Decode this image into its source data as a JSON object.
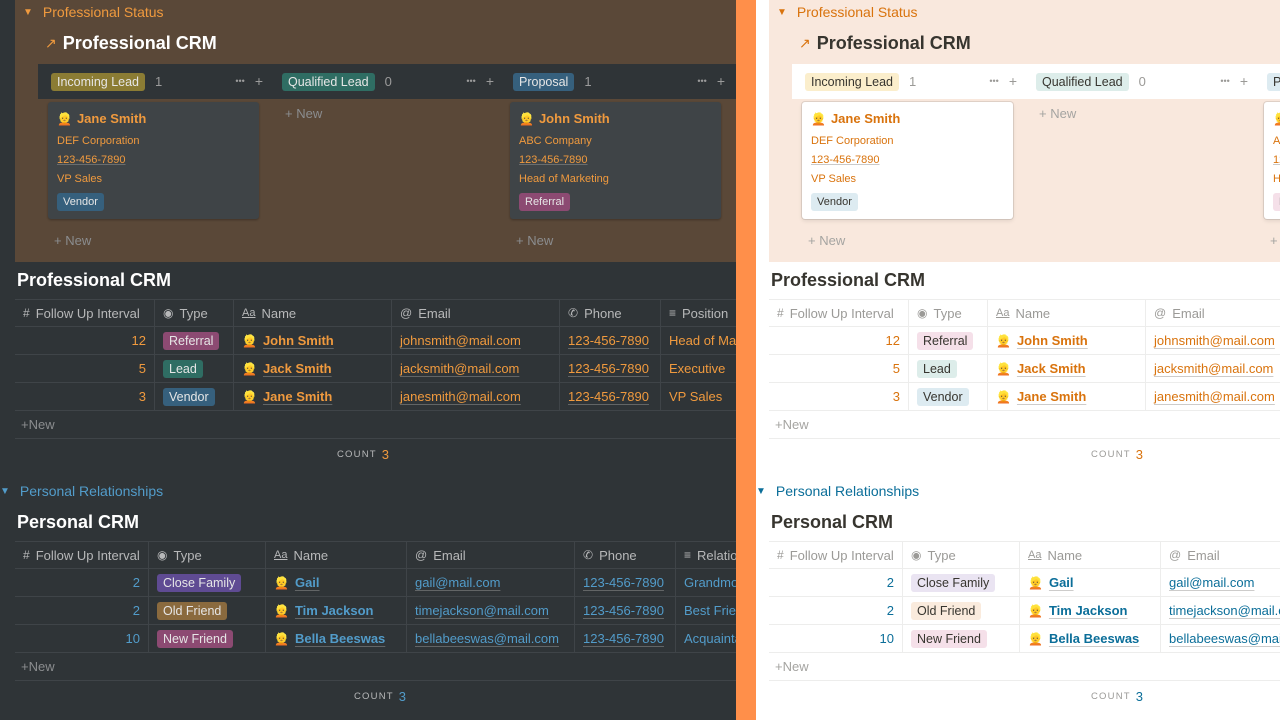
{
  "themes": [
    "dark",
    "light"
  ],
  "divider_color": "#ff8f4a",
  "status_section": {
    "toggle_label": "Professional Status",
    "linked_db_title": "Professional CRM",
    "columns": [
      {
        "label": "Incoming Lead",
        "count": "1",
        "tag_dark": "#8b7c34",
        "tag_light": "#fbeecc"
      },
      {
        "label": "Qualified Lead",
        "count": "0",
        "tag_dark": "#2f6d63",
        "tag_light": "#ddedea"
      },
      {
        "label": "Proposal",
        "count": "1",
        "tag_dark": "#36607d",
        "tag_light": "#ddebf1"
      }
    ],
    "cards": [
      {
        "column": 0,
        "name": "Jane Smith",
        "emoji": "👱",
        "company": "DEF Corporation",
        "phone": "123-456-7890",
        "position": "VP Sales",
        "type": "Vendor"
      },
      {
        "column": 2,
        "name": "John Smith",
        "emoji": "👱",
        "company": "ABC Company",
        "phone": "123-456-7890",
        "position": "Head of Marketing",
        "type": "Referral"
      }
    ],
    "new_label": "New"
  },
  "professional_table": {
    "title": "Professional CRM",
    "headers": [
      {
        "icon": "#",
        "label": "Follow Up Interval"
      },
      {
        "icon": "◉",
        "label": "Type"
      },
      {
        "icon": "Aa",
        "label": "Name"
      },
      {
        "icon": "@",
        "label": "Email"
      },
      {
        "icon": "✆",
        "label": "Phone"
      },
      {
        "icon": "≡",
        "label": "Position"
      }
    ],
    "rows": [
      {
        "interval": "12",
        "type": "Referral",
        "name": "John Smith",
        "email": "johnsmith@mail.com",
        "phone": "123-456-7890",
        "position": "Head of Marketing"
      },
      {
        "interval": "5",
        "type": "Lead",
        "name": "Jack Smith",
        "email": "jacksmith@mail.com",
        "phone": "123-456-7890",
        "position": "Executive"
      },
      {
        "interval": "3",
        "type": "Vendor",
        "name": "Jane Smith",
        "email": "janesmith@mail.com",
        "phone": "123-456-7890",
        "position": "VP Sales"
      }
    ],
    "new_label": "New",
    "count_label": "COUNT",
    "count_value": "3"
  },
  "personal_section": {
    "toggle_label": "Personal Relationships"
  },
  "personal_table": {
    "title": "Personal CRM",
    "headers": [
      {
        "icon": "#",
        "label": "Follow Up Interval"
      },
      {
        "icon": "◉",
        "label": "Type"
      },
      {
        "icon": "Aa",
        "label": "Name"
      },
      {
        "icon": "@",
        "label": "Email"
      },
      {
        "icon": "✆",
        "label": "Phone"
      },
      {
        "icon": "≡",
        "label": "Relationship"
      }
    ],
    "rows": [
      {
        "interval": "2",
        "type": "Close Family",
        "name": "Gail",
        "email": "gail@mail.com",
        "phone": "123-456-7890",
        "relation": "Grandmother"
      },
      {
        "interval": "2",
        "type": "Old Friend",
        "name": "Tim Jackson",
        "email": "timejackson@mail.com",
        "phone": "123-456-7890",
        "relation": "Best Friend"
      },
      {
        "interval": "10",
        "type": "New Friend",
        "name": "Bella Beeswas",
        "email": "bellabeeswas@mail.com",
        "phone": "123-456-7890",
        "relation": "Acquaintance"
      }
    ],
    "new_label": "New",
    "count_label": "COUNT",
    "count_value": "3"
  },
  "tag_colors": {
    "dark": {
      "Referral": "#8c4a72",
      "Lead": "#2f6d63",
      "Vendor": "#36607d",
      "Close Family": "#5f4b93",
      "Old Friend": "#8a6a3e",
      "New Friend": "#8c4a72"
    },
    "light": {
      "Referral": "#f5e0e9",
      "Lead": "#ddedea",
      "Vendor": "#ddebf1",
      "Close Family": "#eae4f2",
      "Old Friend": "#faebdd",
      "New Friend": "#f5e0e9"
    }
  }
}
